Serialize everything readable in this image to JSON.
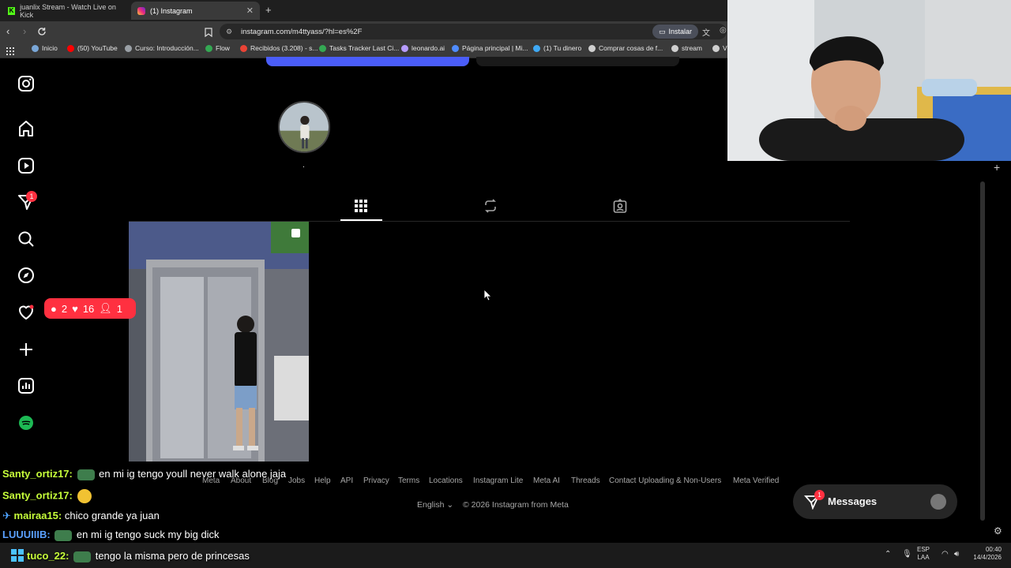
{
  "browser": {
    "tabs": [
      {
        "label": "juanlix Stream - Watch Live on Kick",
        "active": false
      },
      {
        "label": "(1) Instagram",
        "active": true
      }
    ],
    "url": "instagram.com/m4ttyass/?hl=es%2F",
    "install_label": "Instalar",
    "bookmarks": [
      {
        "label": "Inicio",
        "icon": "globe-icon",
        "color": "#7aa7d8"
      },
      {
        "label": "(50) YouTube",
        "icon": "youtube-icon",
        "color": "#ff0000"
      },
      {
        "label": "Curso: Introducción...",
        "icon": "course-icon",
        "color": "#9aa0a6"
      },
      {
        "label": "Flow",
        "icon": "flow-icon",
        "color": "#34a853"
      },
      {
        "label": "Recibidos (3.208) - s...",
        "icon": "gmail-icon",
        "color": "#ea4335"
      },
      {
        "label": "Tasks Tracker Last Ci...",
        "icon": "tasks-icon",
        "color": "#34a853"
      },
      {
        "label": "leonardo.ai",
        "icon": "leonardo-icon",
        "color": "#b79cff"
      },
      {
        "label": "Página principal | Mi...",
        "icon": "page-icon",
        "color": "#4f8cff"
      },
      {
        "label": "(1) Tu dinero",
        "icon": "money-icon",
        "color": "#3fa9f5"
      },
      {
        "label": "Comprar cosas de f...",
        "icon": "folder-icon",
        "color": "#cfcfcf"
      },
      {
        "label": "stream",
        "icon": "folder-icon",
        "color": "#cfcfcf"
      },
      {
        "label": "V",
        "icon": "folder-icon",
        "color": "#cfcfcf"
      }
    ]
  },
  "instagram": {
    "sidebar": [
      {
        "name": "instagram-logo-icon"
      },
      {
        "name": "home-icon"
      },
      {
        "name": "reels-icon"
      },
      {
        "name": "messages-icon",
        "badge": "1"
      },
      {
        "name": "search-icon"
      },
      {
        "name": "explore-icon"
      },
      {
        "name": "notifications-icon"
      },
      {
        "name": "create-icon"
      },
      {
        "name": "dashboard-icon"
      },
      {
        "name": "threads-icon"
      }
    ],
    "profile_name": ".",
    "notification_popup": {
      "comments": "2",
      "likes": "16",
      "follows": "1"
    },
    "profile_tabs": [
      "posts-grid-icon",
      "reposts-icon",
      "tagged-icon"
    ],
    "footer_links": [
      "Meta",
      "About",
      "Blog",
      "Jobs",
      "Help",
      "API",
      "Privacy",
      "Terms",
      "Locations",
      "Instagram Lite",
      "Meta AI",
      "Threads",
      "Contact Uploading & Non-Users",
      "Meta Verified"
    ],
    "language": "English",
    "copyright": "© 2026 Instagram from Meta",
    "messages_label": "Messages",
    "messages_badge": "1"
  },
  "chat": [
    {
      "user": "Santy_ortiz17:",
      "message": "en mi ig tengo youll never walk alone jaja"
    },
    {
      "user": "Santy_ortiz17:",
      "message": ""
    },
    {
      "user": "mairaa15:",
      "message": "chico grande ya juan"
    },
    {
      "user": "LUUUIIIB:",
      "message": "en mi ig tengo suck my big dick"
    },
    {
      "user": "tuco_22:",
      "message": "tengo la misma pero de princesas"
    }
  ],
  "taskbar": {
    "lang_line1": "ESP",
    "lang_line2": "LAA",
    "time": "00:40",
    "date": "14/4/2026"
  },
  "colors": {
    "accent_red": "#ff3040",
    "chat_user": "#c7ff3a"
  }
}
